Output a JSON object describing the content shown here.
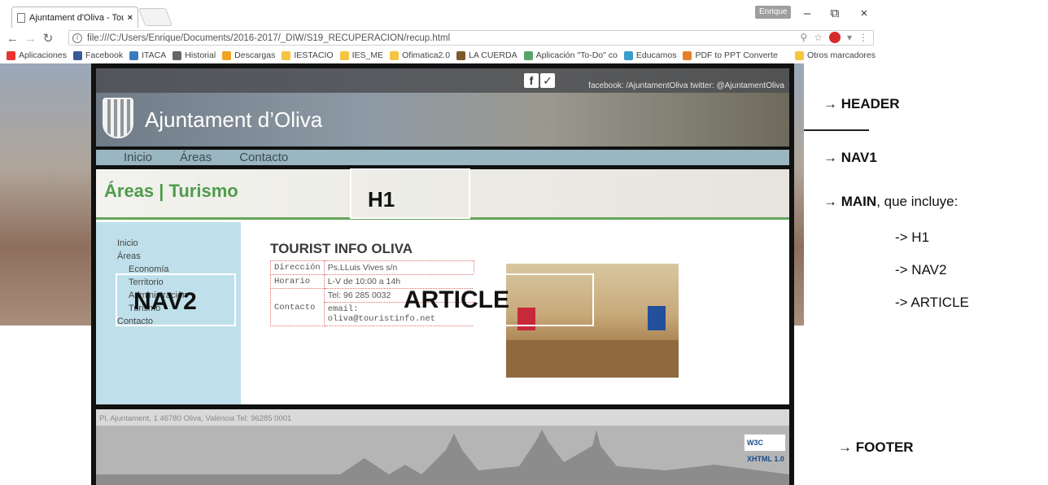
{
  "browser": {
    "tab_title": "Ajuntament d'Oliva - Tou",
    "tab_close": "×",
    "user_badge": "Enrique",
    "window_controls": {
      "minimize": "–",
      "restore": "⧉",
      "close": "×"
    },
    "url": "file:///C:/Users/Enrique/Documents/2016-2017/_DIW/S19_RECUPERACION/recup.html",
    "bookmarks": [
      {
        "label": "Aplicaciones",
        "color": "#e7352f"
      },
      {
        "label": "Facebook",
        "color": "#3b5998"
      },
      {
        "label": "ITACA",
        "color": "#3a7bbf"
      },
      {
        "label": "Historial",
        "color": "#666666"
      },
      {
        "label": "Descargas",
        "color": "#f2a31f"
      },
      {
        "label": "IESTACIO",
        "color": "#f5c542"
      },
      {
        "label": "IES_ME",
        "color": "#f5c542"
      },
      {
        "label": "Ofimatica2.0",
        "color": "#f5c542"
      },
      {
        "label": "LA CUERDA",
        "color": "#7f5a2a"
      },
      {
        "label": "Aplicación \"To-Do\" co",
        "color": "#5aa469"
      },
      {
        "label": "Educamos",
        "color": "#3a9ccf"
      },
      {
        "label": "PDF to PPT Converte",
        "color": "#e47f2a"
      }
    ],
    "other_bookmarks": "Otros marcadores"
  },
  "site": {
    "header": {
      "social_text": "facebook: /AjuntamentOliva  twitter: @AjuntamentOliva",
      "title": "Ajuntament d’Oliva"
    },
    "nav1": [
      "Inicio",
      "Áreas",
      "Contacto"
    ],
    "h1": "Áreas | Turismo",
    "nav2": {
      "items": [
        "Inicio",
        "Áreas"
      ],
      "subitems": [
        "Economía",
        "Territorio",
        "Administración",
        "Turismo"
      ],
      "last": "Contacto"
    },
    "article": {
      "title": "TOURIST INFO OLIVA",
      "rows": {
        "direccion_label": "Dirección",
        "direccion_value": "Ps.LLuis Vives s/n",
        "horario_label": "Horario",
        "horario_value": "L-V de 10:00 a 14h",
        "contacto_label": "Contacto",
        "tel_value": "Tel: 96 285 0032",
        "email_value": "email: oliva@touristinfo.net"
      }
    },
    "footer": {
      "address": "Pl. Ajuntament, 1 46780 Oliva, València Tel: 96285 0001",
      "badge": "W3C XHTML 1.0"
    }
  },
  "overlay_labels": {
    "h1": "H1",
    "nav2": "NAV2",
    "article": "ARTICLE"
  },
  "annotations": {
    "header": "HEADER",
    "nav1": "NAV1",
    "main_bold": "MAIN",
    "main_rest": ", que incluye:",
    "main_items": [
      "-> H1",
      "-> NAV2",
      "-> ARTICLE"
    ],
    "footer": "FOOTER",
    "arrow": "→"
  }
}
